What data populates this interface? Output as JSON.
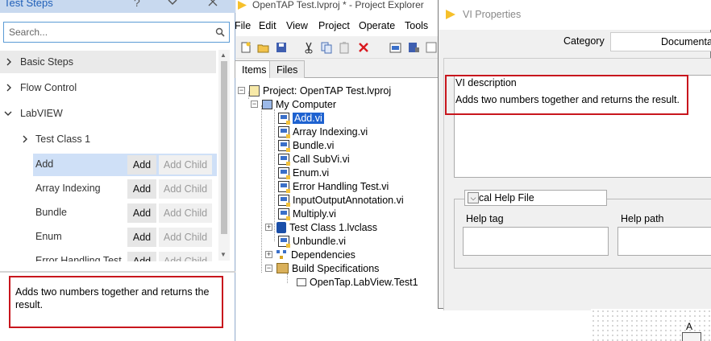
{
  "test_steps": {
    "title": "Test Steps",
    "help_button": "?",
    "collapse_button": "⌄",
    "close_button": "✕",
    "search_placeholder": "Search...",
    "groups": [
      {
        "label": "Basic Steps",
        "expanded": false
      },
      {
        "label": "Flow Control",
        "expanded": false
      },
      {
        "label": "LabVIEW",
        "expanded": true
      },
      {
        "label": "Test Class 1",
        "expanded": false
      }
    ],
    "steps": [
      {
        "label": "Add",
        "add": "Add",
        "add_child": "Add Child",
        "selected": true
      },
      {
        "label": "Array Indexing",
        "add": "Add",
        "add_child": "Add Child",
        "selected": false
      },
      {
        "label": "Bundle",
        "add": "Add",
        "add_child": "Add Child",
        "selected": false
      },
      {
        "label": "Enum",
        "add": "Add",
        "add_child": "Add Child",
        "selected": false
      },
      {
        "label": "Error Handling Test",
        "add": "Add",
        "add_child": "Add Child",
        "selected": false
      }
    ],
    "description": "Adds two numbers together and returns the result."
  },
  "project_explorer": {
    "title": "OpenTAP Test.lvproj * - Project Explorer",
    "menu": [
      "File",
      "Edit",
      "View",
      "Project",
      "Operate",
      "Tools"
    ],
    "tabs": [
      "Items",
      "Files"
    ],
    "active_tab": "Items",
    "tree": {
      "project": "Project: OpenTAP Test.lvproj",
      "computer": "My Computer",
      "items": [
        "Add.vi",
        "Array Indexing.vi",
        "Bundle.vi",
        "Call SubVi.vi",
        "Enum.vi",
        "Error Handling Test.vi",
        "InputOutputAnnotation.vi",
        "Multiply.vi",
        "Test Class 1.lvclass",
        "Unbundle.vi",
        "Dependencies",
        "Build Specifications"
      ],
      "selected": "Add.vi",
      "build_child": "OpenTap.LabView.Test1"
    }
  },
  "vi_properties": {
    "title": "VI Properties",
    "category_label": "Category",
    "category_value": "Documentat",
    "description_label": "VI description",
    "description_text": "Adds two numbers together and returns the result.",
    "help_file_option": "Local Help File",
    "help_tag_label": "Help tag",
    "help_path_label": "Help path"
  },
  "block_diagram": {
    "label": "A"
  },
  "colors": {
    "accent": "#1e62d0",
    "highlight": "#c8161d",
    "selected_row": "#cfe0f7"
  },
  "icons": [
    "search-icon",
    "chevron-right-icon",
    "chevron-down-icon",
    "labview-icon",
    "vi-icon",
    "class-icon",
    "dependencies-icon",
    "build-spec-icon"
  ]
}
